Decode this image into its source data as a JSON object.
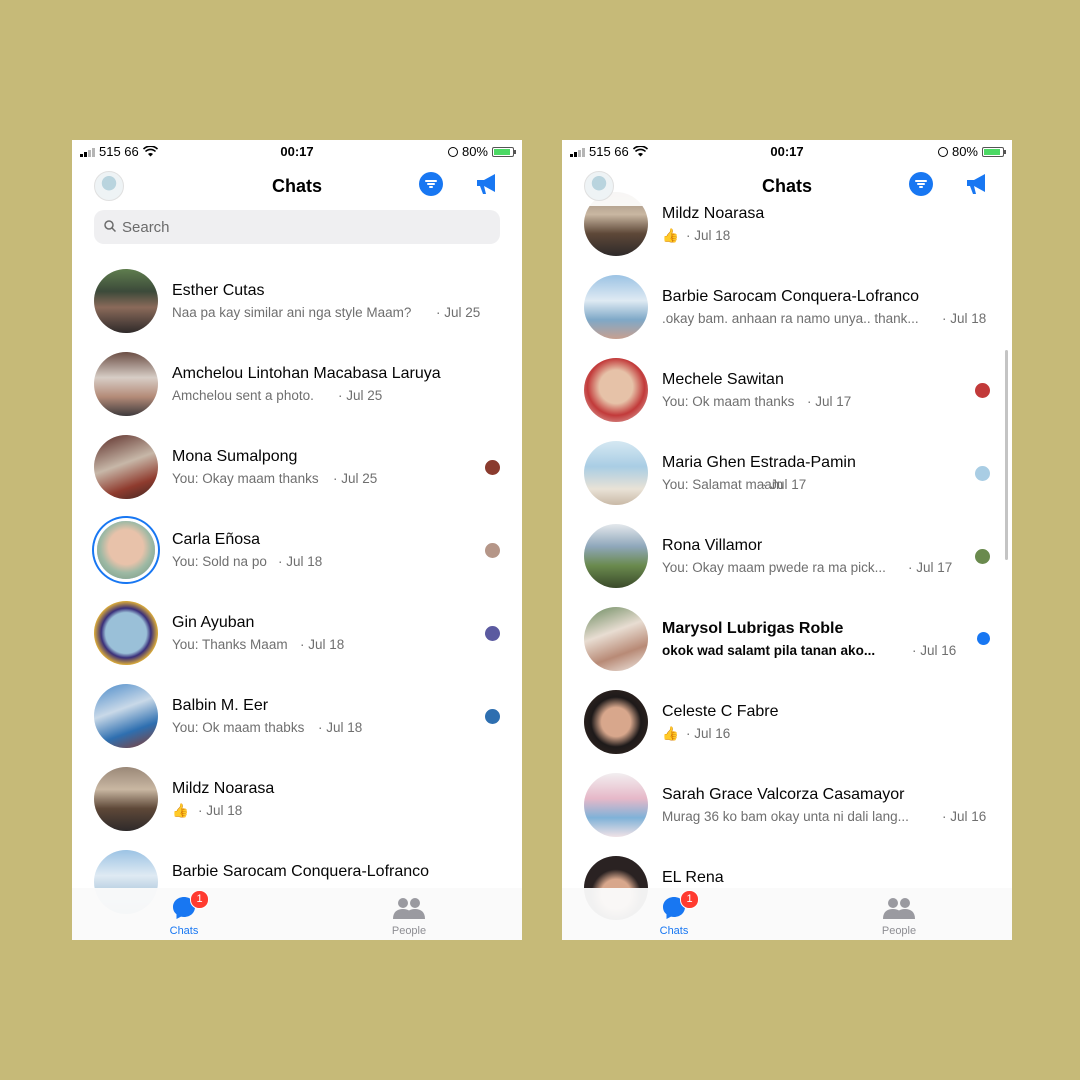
{
  "colors": {
    "background": "#c6ba78",
    "accent": "#1877f2",
    "badge": "#ff3b30"
  },
  "phones": [
    {
      "status": {
        "carrier": "515 66",
        "time": "00:17",
        "battery": "80%"
      },
      "header": {
        "title": "Chats"
      },
      "search": {
        "placeholder": "Search"
      },
      "chats": [
        {
          "name": "Esther Cutas",
          "preview": "Naa pa kay similar ani nga style Maam?",
          "date": "· Jul 25"
        },
        {
          "name": "Amchelou Lintohan Macabasa Laruya",
          "preview": "Amchelou sent a photo.",
          "date": "· Jul 25"
        },
        {
          "name": "Mona Sumalpong",
          "preview": "You: Okay maam thanks",
          "date": "· Jul 25"
        },
        {
          "name": "Carla Eñosa",
          "preview": "You: Sold na po",
          "date": "· Jul 18"
        },
        {
          "name": "Gin Ayuban",
          "preview": "You: Thanks Maam",
          "date": "· Jul 18"
        },
        {
          "name": "Balbin M. Eer",
          "preview": "You: Ok maam thabks",
          "date": "· Jul 18"
        },
        {
          "name": "Mildz Noarasa",
          "preview": "👍",
          "date": "· Jul 18"
        },
        {
          "name": "Barbie Sarocam Conquera-Lofranco",
          "preview": "",
          "date": ""
        }
      ],
      "tabs": {
        "chats": "Chats",
        "people": "People",
        "badge": "1"
      }
    },
    {
      "status": {
        "carrier": "515 66",
        "time": "00:17",
        "battery": "80%"
      },
      "header": {
        "title": "Chats"
      },
      "chats": [
        {
          "name": "Mildz Noarasa",
          "preview": "👍",
          "date": "· Jul 18"
        },
        {
          "name": "Barbie Sarocam Conquera-Lofranco",
          "preview": ".okay bam. anhaan ra namo unya.. thank...",
          "date": "· Jul 18"
        },
        {
          "name": "Mechele Sawitan",
          "preview": "You: Ok maam thanks",
          "date": "· Jul 17"
        },
        {
          "name": "Maria Ghen Estrada-Pamin",
          "preview": "You: Salamat maam",
          "date": "· Jul 17"
        },
        {
          "name": "Rona Villamor",
          "preview": "You: Okay maam pwede ra ma pick...",
          "date": "· Jul 17"
        },
        {
          "name": "Marysol Lubrigas Roble",
          "preview": "okok wad salamt pila tanan ako...",
          "date": "· Jul 16"
        },
        {
          "name": "Celeste C Fabre",
          "preview": "👍",
          "date": "· Jul 16"
        },
        {
          "name": "Sarah Grace Valcorza Casamayor",
          "preview": "Murag 36 ko bam okay unta ni dali lang...",
          "date": "· Jul 16"
        },
        {
          "name": "EL Rena",
          "preview": "",
          "date": ""
        }
      ],
      "tabs": {
        "chats": "Chats",
        "people": "People",
        "badge": "1"
      }
    }
  ]
}
